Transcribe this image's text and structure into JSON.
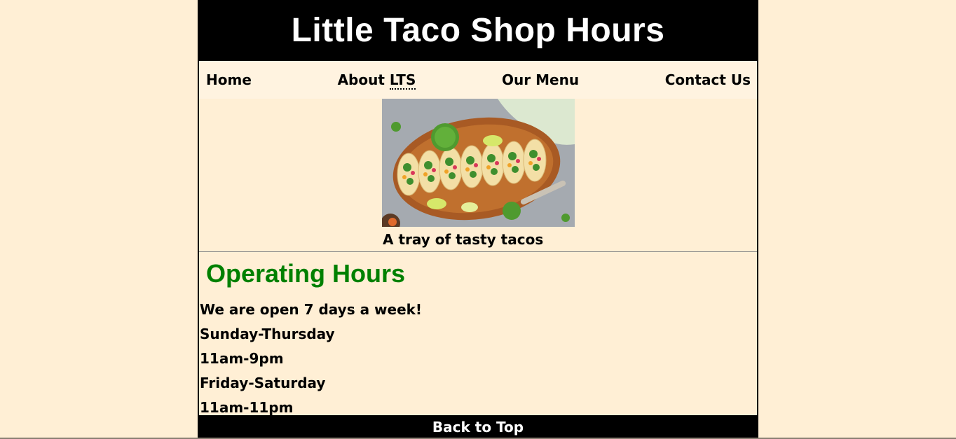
{
  "header": {
    "title": "Little Taco Shop Hours"
  },
  "nav": {
    "items": [
      {
        "label": "Home"
      },
      {
        "label_prefix": "About ",
        "label_abbr": "LTS"
      },
      {
        "label": "Our Menu"
      },
      {
        "label": "Contact Us"
      }
    ]
  },
  "figure": {
    "image_alt": "A tray of tasty tacos",
    "caption": "A tray of tasty tacos"
  },
  "hours": {
    "heading": "Operating Hours",
    "lines": [
      "We are open 7 days a week!",
      "Sunday-Thursday",
      "11am-9pm",
      "Friday-Saturday",
      "11am-11pm"
    ]
  },
  "footer": {
    "back_to_top": "Back to Top"
  },
  "colors": {
    "background": "#ffefd5",
    "nav_background": "#fff3e0",
    "header_background": "#000000",
    "heading_green": "#008000"
  }
}
